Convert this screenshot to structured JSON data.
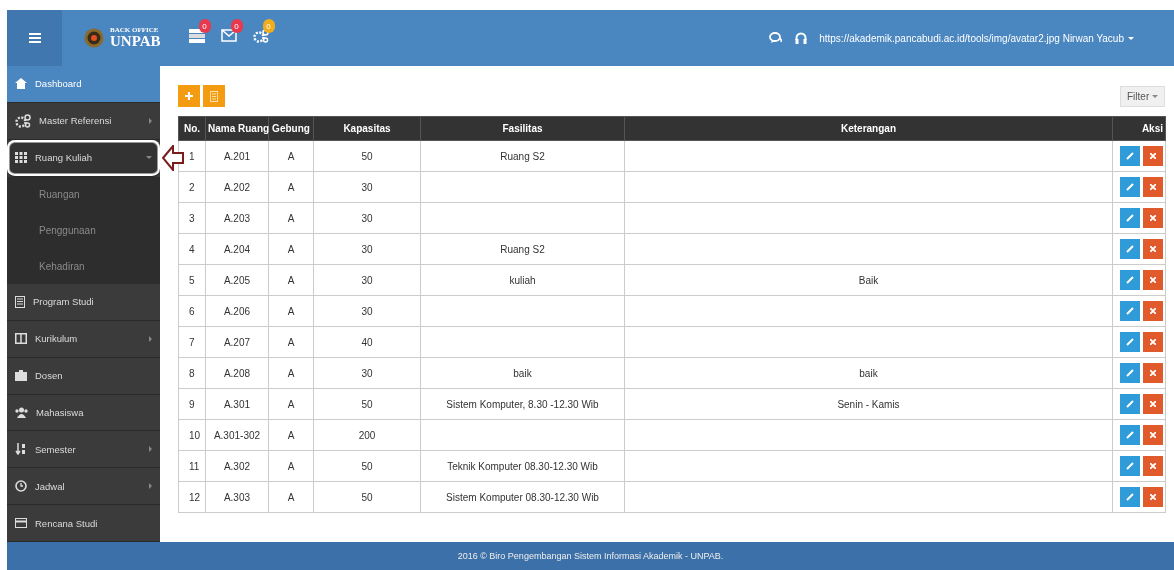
{
  "header": {
    "brand_top": "BACK OFFICE",
    "brand_name": "UNPAB",
    "notifications": [
      {
        "count": "0",
        "color": "#e8394d"
      },
      {
        "count": "0",
        "color": "#e8394d"
      },
      {
        "count": "0",
        "color": "#f0ad1c"
      }
    ],
    "user": "https://akademik.pancabudi.ac.id/tools/img/avatar2.jpg Nirwan Yacub"
  },
  "sidebar": {
    "items": [
      {
        "label": "Dashboard",
        "selected": true,
        "submenu": false,
        "expanded": false,
        "highlighted": false
      },
      {
        "label": "Master Referensi",
        "selected": false,
        "submenu": true,
        "expanded": false,
        "highlighted": false
      },
      {
        "label": "Ruang Kuliah",
        "selected": false,
        "submenu": true,
        "expanded": true,
        "highlighted": true,
        "children": [
          {
            "label": "Ruangan"
          },
          {
            "label": "Penggunaan"
          },
          {
            "label": "Kehadiran"
          }
        ]
      },
      {
        "label": "Program Studi",
        "selected": false,
        "submenu": false,
        "expanded": false,
        "highlighted": false
      },
      {
        "label": "Kurikulum",
        "selected": false,
        "submenu": true,
        "expanded": false,
        "highlighted": false
      },
      {
        "label": "Dosen",
        "selected": false,
        "submenu": false,
        "expanded": false,
        "highlighted": false
      },
      {
        "label": "Mahasiswa",
        "selected": false,
        "submenu": false,
        "expanded": false,
        "highlighted": false
      },
      {
        "label": "Semester",
        "selected": false,
        "submenu": true,
        "expanded": false,
        "highlighted": false
      },
      {
        "label": "Jadwal",
        "selected": false,
        "submenu": true,
        "expanded": false,
        "highlighted": false
      },
      {
        "label": "Rencana Studi",
        "selected": false,
        "submenu": false,
        "expanded": false,
        "highlighted": false
      }
    ]
  },
  "toolbar": {
    "filter": "Filter"
  },
  "table": {
    "columns": [
      "No.",
      "Nama Ruang",
      "Gebung",
      "Kapasitas",
      "Fasilitas",
      "Keterangan",
      "Aksi"
    ],
    "rows": [
      [
        "1",
        "A.201",
        "A",
        "50",
        "Ruang S2",
        ""
      ],
      [
        "2",
        "A.202",
        "A",
        "30",
        "",
        ""
      ],
      [
        "3",
        "A.203",
        "A",
        "30",
        "",
        ""
      ],
      [
        "4",
        "A.204",
        "A",
        "30",
        "Ruang S2",
        ""
      ],
      [
        "5",
        "A.205",
        "A",
        "30",
        "kuliah",
        "Baik"
      ],
      [
        "6",
        "A.206",
        "A",
        "30",
        "",
        ""
      ],
      [
        "7",
        "A.207",
        "A",
        "40",
        "",
        ""
      ],
      [
        "8",
        "A.208",
        "A",
        "30",
        "baik",
        "baik"
      ],
      [
        "9",
        "A.301",
        "A",
        "50",
        "Sistem Komputer, 8.30 -12.30 Wib",
        "Senin - Kamis"
      ],
      [
        "10",
        "A.301-302",
        "A",
        "200",
        "",
        ""
      ],
      [
        "11",
        "A.302",
        "A",
        "50",
        "Teknik Komputer 08.30-12.30 Wib",
        ""
      ],
      [
        "12",
        "A.303",
        "A",
        "50",
        "Sistem Komputer 08.30-12.30 Wib",
        ""
      ]
    ]
  },
  "footer": "2016 © Biro Pengembangan Sistem Informasi Akademik - UNPAB."
}
